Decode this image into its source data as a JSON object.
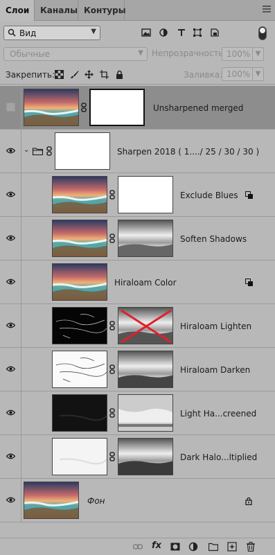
{
  "tabs": [
    {
      "label": "Слои",
      "active": true
    },
    {
      "label": "Каналы",
      "active": false
    },
    {
      "label": "Контуры",
      "active": false
    }
  ],
  "filter": {
    "selected": "Вид",
    "icons": [
      "image-filter-icon",
      "adjustment-filter-icon",
      "type-filter-icon",
      "shape-filter-icon",
      "smart-object-filter-icon"
    ]
  },
  "blend": {
    "mode": "Обычные",
    "opacity_label": "Непрозрачность:",
    "opacity_value": "100%"
  },
  "lock": {
    "label": "Закрепить:",
    "fill_label": "Заливка:",
    "fill_value": "100%"
  },
  "layers": [
    {
      "name": "Unsharpened merged",
      "visible": false,
      "selected": true,
      "has_mask": true
    },
    {
      "name": "Sharpen 2018 ( 1..../ 25 / 30 / 30 )",
      "visible": true,
      "group": true
    },
    {
      "name": "Exclude Blues",
      "visible": true,
      "has_mask": true,
      "smart_filter_badge": true
    },
    {
      "name": "Soften Shadows",
      "visible": true,
      "has_mask": true
    },
    {
      "name": "Hiraloam Color",
      "visible": true,
      "has_mask": false,
      "smart_filter_badge": true
    },
    {
      "name": "Hiraloam Lighten",
      "visible": true,
      "has_mask": true,
      "mask_disabled": true
    },
    {
      "name": "Hiraloam Darken",
      "visible": true,
      "has_mask": true
    },
    {
      "name": "Light Ha...creened",
      "visible": true,
      "has_mask": true
    },
    {
      "name": "Dark Halo...ltiplied",
      "visible": true,
      "has_mask": true
    },
    {
      "name": "Фон",
      "visible": true,
      "locked": true,
      "background": true
    }
  ],
  "bottom_icons": [
    "link-layers-icon",
    "fx-icon",
    "add-mask-icon",
    "adjustment-layer-icon",
    "new-group-icon",
    "new-layer-icon",
    "delete-layer-icon"
  ],
  "bottom_fx_label": "fx",
  "colors": {
    "panel_bg": "#b8b8b8",
    "selected_row": "#8d8d8d",
    "tab_active": "#bcbcbc",
    "mask_disable_x": "#e0202a"
  }
}
